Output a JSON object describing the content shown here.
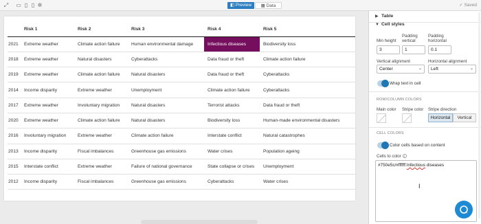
{
  "topbar": {
    "preview_label": "Preview",
    "data_label": "Data",
    "saved_label": "Saved"
  },
  "table": {
    "headers": [
      "",
      "Risk 1",
      "Risk 2",
      "Risk 3",
      "Risk 4",
      "Risk 5"
    ],
    "rows": [
      [
        "2021",
        "Extreme weather",
        "Climate action failure",
        "Human environmental damage",
        "Infectious diseases",
        "Biodiversity loss"
      ],
      [
        "2018",
        "Extreme weather",
        "Natural disasters",
        "Cyberattacks",
        "Data fraud or theft",
        "Climate action failure"
      ],
      [
        "2019",
        "Extreme weather",
        "Climate action failure",
        "Natural disasters",
        "Data fraud or theft",
        "Cyberattacks"
      ],
      [
        "2014",
        "Income disparity",
        "Extreme weather",
        "Unemployment",
        "Climate action failure",
        "Cyberattacks"
      ],
      [
        "2017",
        "Extreme weather",
        "Involuntary migration",
        "Natural disasters",
        "Terrorist attacks",
        "Data fraud or theft"
      ],
      [
        "2020",
        "Extreme weather",
        "Climate action failure",
        "Natural disasters",
        "Biodiversity loss",
        "Human-made environmental disasters"
      ],
      [
        "2016",
        "Involuntary migration",
        "Extreme weather",
        "Climate action failure",
        "Interstate conflict",
        "Natural catastrophes"
      ],
      [
        "2013",
        "Income disparity",
        "Fiscal imbalances",
        "Greenhouse gas emissions",
        "Water crises",
        "Population ageing"
      ],
      [
        "2015",
        "Interstate conflict",
        "Extreme weather",
        "Failure of national governance",
        "State collapse or crises",
        "Unemployment"
      ],
      [
        "2012",
        "Income disparity",
        "Fiscal imbalances",
        "Greenhouse gas emissions",
        "Cyberattacks",
        "Water crises"
      ]
    ],
    "highlight_color": "#750e5c"
  },
  "sidebar": {
    "table_section": "Table",
    "cell_styles_section": "Cell styles",
    "min_height_label": "Min height",
    "min_height_value": "3",
    "padding_vertical_label": "Padding vertical",
    "padding_vertical_value": "1",
    "padding_horizontal_label": "Padding horizontal",
    "padding_horizontal_value": "0.1",
    "vertical_alignment_label": "Vertical alignment",
    "vertical_alignment_value": "Center",
    "horizontal_alignment_label": "Horizontal alignment",
    "horizontal_alignment_value": "Left",
    "wrap_text_label": "Wrap text in cell",
    "row_column_colors_label": "ROW/COLUMN COLORS",
    "main_color_label": "Main color",
    "stripe_color_label": "Stripe color",
    "stripe_direction_label": "Stripe direction",
    "stripe_horizontal": "Horizontal",
    "stripe_vertical": "Vertical",
    "cell_colors_label": "CELL COLORS",
    "color_cells_label": "Color cells based on content",
    "cells_to_color_label": "Cells to color",
    "cells_to_color_value_a": "#750e5c/#ffffff:",
    "cells_to_color_value_b": "Infectious",
    "cells_to_color_value_c": " diseases",
    "accent_color": "#1f77b4"
  }
}
